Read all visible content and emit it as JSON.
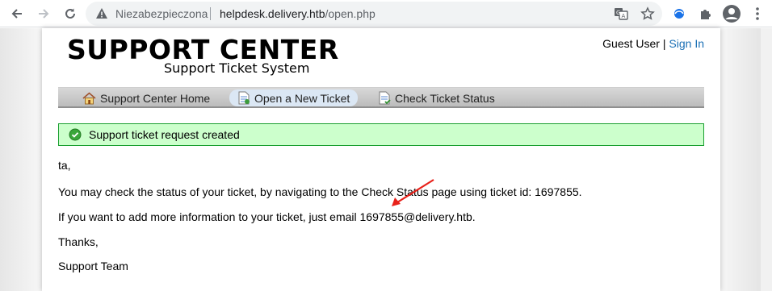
{
  "browser": {
    "security_label": "Niezabezpieczona",
    "url_host": "helpdesk.delivery.htb",
    "url_path": "/open.php",
    "icons": [
      "back-icon",
      "forward-icon",
      "reload-icon",
      "warning-icon",
      "translate-icon",
      "star-icon",
      "extension-icon",
      "puzzle-icon",
      "profile-icon",
      "menu-icon"
    ]
  },
  "header": {
    "title": "SUPPORT CENTER",
    "subtitle": "Support Ticket System",
    "user_label": "Guest User",
    "separator": "|",
    "signin_label": "Sign In"
  },
  "nav": {
    "items": [
      {
        "label": "Support Center Home",
        "icon": "home-icon"
      },
      {
        "label": "Open a New Ticket",
        "icon": "new-ticket-icon"
      },
      {
        "label": "Check Ticket Status",
        "icon": "ticket-status-icon"
      }
    ],
    "active_index": 1
  },
  "alert": {
    "text": "Support ticket request created",
    "color": "#ccffcc"
  },
  "message": {
    "greeting": "ta,",
    "line1": "You may check the status of your ticket, by navigating to the Check Status page using ticket id: 1697855.",
    "line2": "If you want to add more information to your ticket, just email 1697855@delivery.htb.",
    "closing": "Thanks,",
    "signature": "Support Team"
  },
  "annotation": {
    "arrow_color": "#e8211a"
  }
}
